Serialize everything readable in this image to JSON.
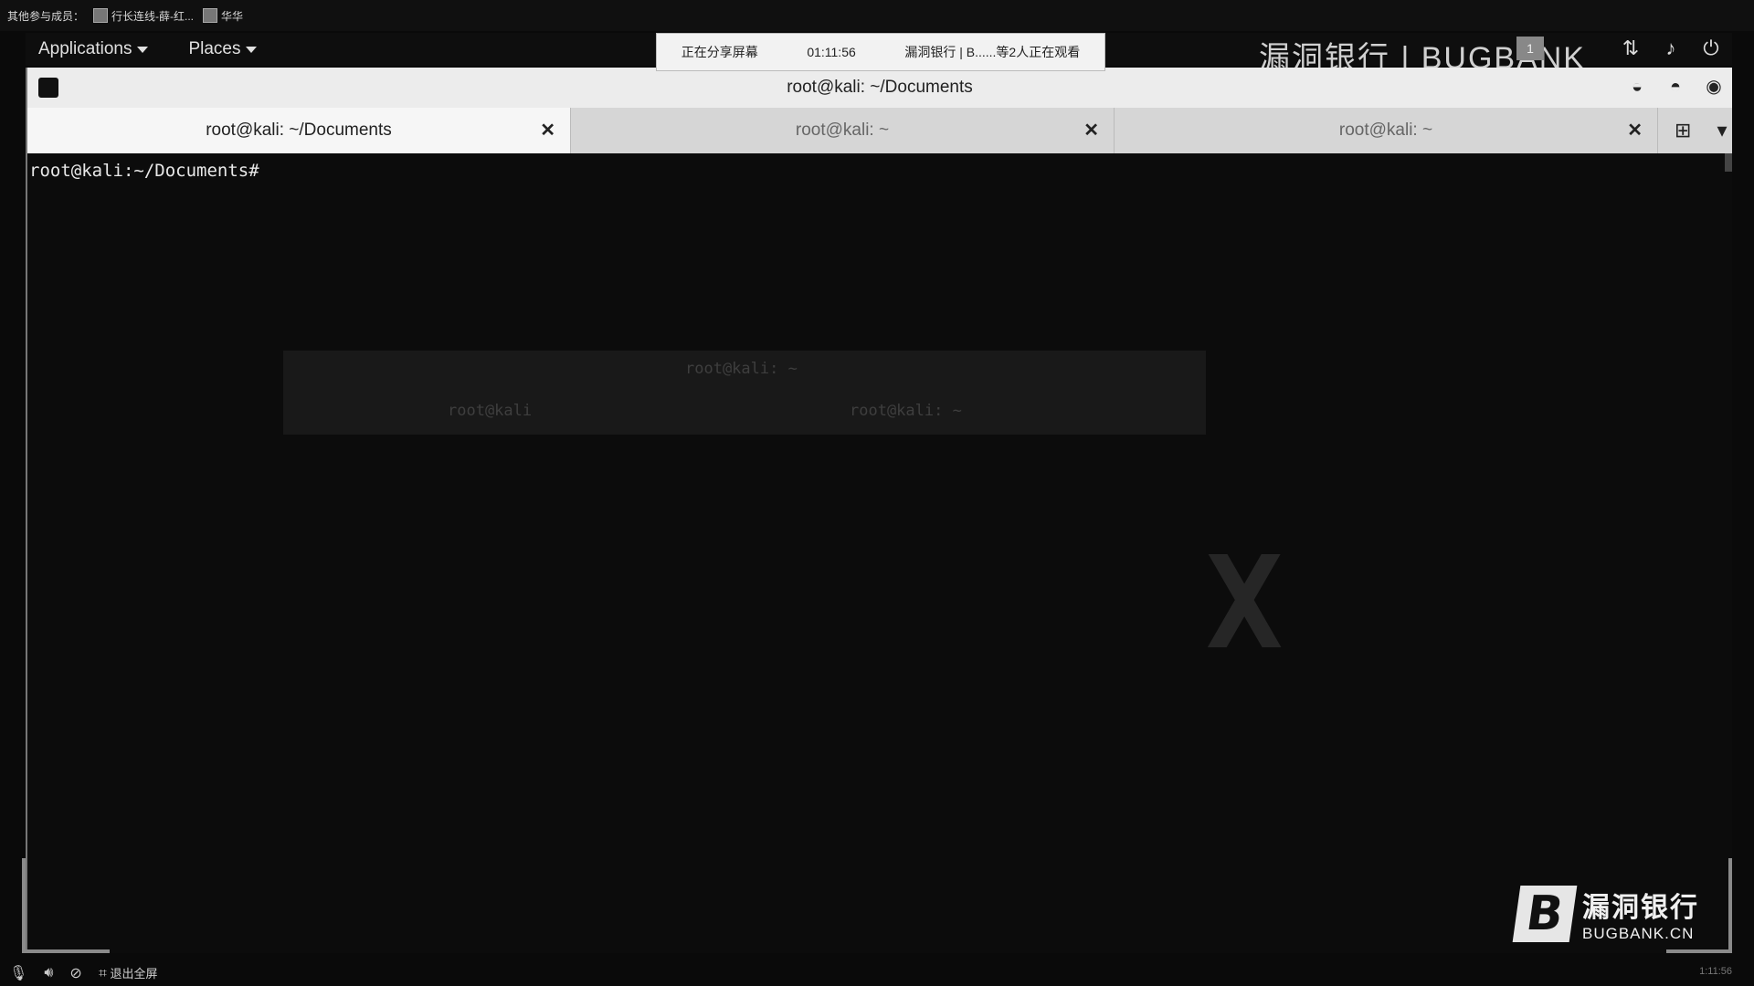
{
  "meeting_bar": {
    "members_label": "其他参与成员：",
    "participants": [
      {
        "name": "行长连线-薛-红..."
      },
      {
        "name": "华华"
      }
    ]
  },
  "share_notice": {
    "status": "正在分享屏幕",
    "timer": "01:11:56",
    "viewers": "漏洞银行 | B......等2人正在观看"
  },
  "kali_panel": {
    "applications_label": "Applications",
    "places_label": "Places",
    "bg_brand": "漏洞银行 | BUGBANK",
    "workspace_number": "1"
  },
  "terminal": {
    "window_title": "root@kali: ~/Documents",
    "tabs": [
      {
        "label": "root@kali: ~/Documents",
        "active": true
      },
      {
        "label": "root@kali: ~",
        "active": false
      },
      {
        "label": "root@kali: ~",
        "active": false
      }
    ],
    "prompt": "root@kali:~/Documents#",
    "ghost_title": "root@kali: ~",
    "ghost_tab1": "root@kali",
    "ghost_tab2": "root@kali: ~"
  },
  "watermark": {
    "cn": "漏洞银行",
    "en": "BUGBANK.CN"
  },
  "bottom_bar": {
    "exit_fullscreen": "退出全屏",
    "time": "1:11:56"
  },
  "icons": [
    "mic-icon",
    "speaker-icon",
    "camera-off-icon",
    "fullscreen-exit-icon",
    "power-icon",
    "volume-icon",
    "network-icon",
    "new-tab-icon",
    "tab-menu-icon"
  ]
}
